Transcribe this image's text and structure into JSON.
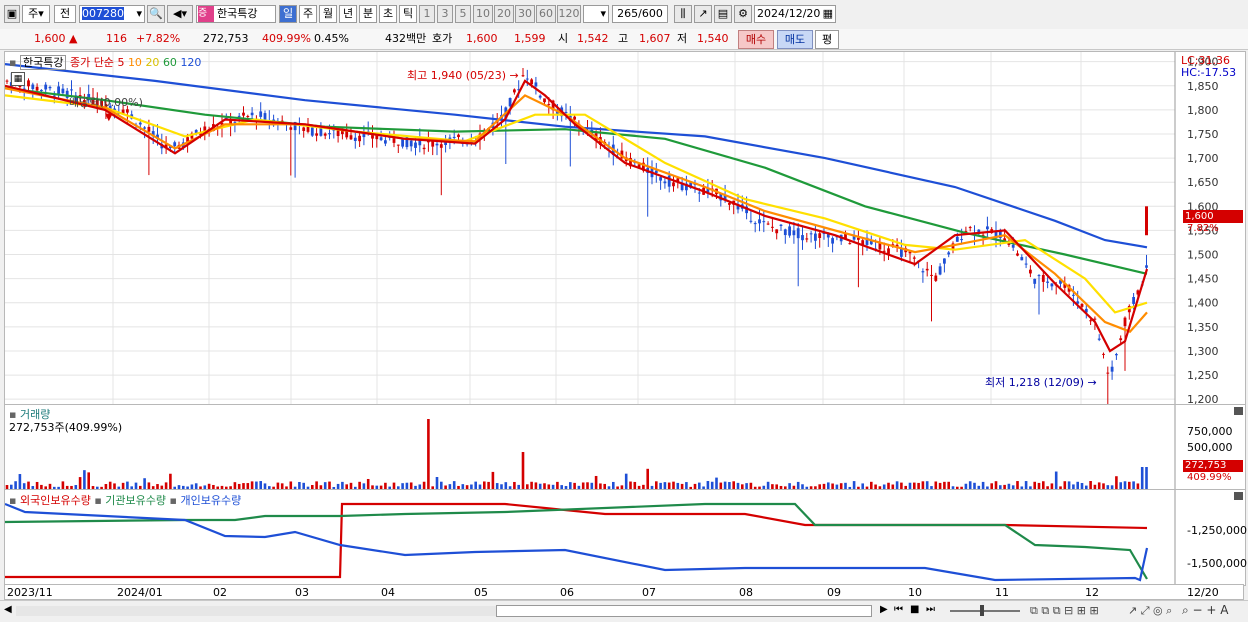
{
  "toolbar": {
    "mode1": "주",
    "mode2": "전",
    "stock_code": "007280",
    "stock_name": "한국특강",
    "name_badge": "증",
    "periods": [
      "일",
      "주",
      "월",
      "년",
      "분",
      "초",
      "틱"
    ],
    "intervals": [
      "1",
      "3",
      "5",
      "10",
      "20",
      "30",
      "60",
      "120"
    ],
    "count_value": "265",
    "count_total": "/600",
    "date": "2024/12/20"
  },
  "quote": {
    "price": "1,600",
    "change": "116",
    "change_pct": "+7.82%",
    "volume": "272,753",
    "volume_ratio": "409.99%",
    "turnover": "0.45%",
    "amount": "432백만",
    "hoga_label": "호가",
    "ask": "1,600",
    "bid": "1,599",
    "open_label": "시",
    "open": "1,542",
    "high_label": "고",
    "high": "1,607",
    "low_label": "저",
    "low": "1,540",
    "buy_label": "매수",
    "sell_label": "매도",
    "eval_label": "평"
  },
  "price_panel": {
    "title": "한국특강",
    "indicator": "종가 단순",
    "ma_periods": [
      "5",
      "10",
      "20",
      "60",
      "120"
    ],
    "ma_colors": [
      "#d40000",
      "#ff8c00",
      "#ffe000",
      "#1f9a3a",
      "#1e4fd6"
    ],
    "lc": "LC:31.36",
    "hc": "HC:-17.53",
    "dividend_label": "배당락(0.00%)",
    "high_note": "최고 1,940 (05/23)",
    "low_note": "최저 1,218 (12/09)",
    "last_price_tag": "1,600",
    "last_pct_tag": "7.82%",
    "y_ticks": [
      "1,900",
      "1,850",
      "1,800",
      "1,750",
      "1,700",
      "1,650",
      "1,600",
      "1,550",
      "1,500",
      "1,450",
      "1,400",
      "1,350",
      "1,300",
      "1,250",
      "1,200"
    ]
  },
  "volume_panel": {
    "title": "거래량",
    "summary": "272,753주(409.99%)",
    "y_ticks": [
      "750,000",
      "500,000"
    ],
    "last_tag": "272,753",
    "last_pct": "409.99%"
  },
  "holding_panel": {
    "series": [
      "외국인보유수량",
      "기관보유수량",
      "개인보유수량"
    ],
    "y_ticks": [
      "-1,250,000",
      "-1,500,000"
    ]
  },
  "x_axis": [
    "2023/11",
    "2024/01",
    "02",
    "03",
    "04",
    "05",
    "06",
    "07",
    "08",
    "09",
    "10",
    "11",
    "12",
    "12/20"
  ]
}
